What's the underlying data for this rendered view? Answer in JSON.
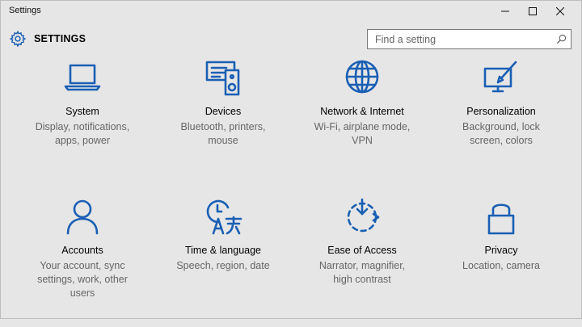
{
  "window": {
    "title": "Settings",
    "controls": [
      "minimize-icon",
      "maximize-icon",
      "close-icon"
    ]
  },
  "header": {
    "title": "SETTINGS",
    "icon": "gear-icon"
  },
  "search": {
    "placeholder": "Find a setting",
    "value": "",
    "icon": "search-icon"
  },
  "tiles": [
    {
      "label": "System",
      "desc1": "Display, notifications,",
      "desc2": "apps, power",
      "desc3": "",
      "icon": "laptop-icon"
    },
    {
      "label": "Devices",
      "desc1": "Bluetooth, printers,",
      "desc2": "mouse",
      "desc3": "",
      "icon": "devices-icon"
    },
    {
      "label": "Network & Internet",
      "desc1": "Wi-Fi, airplane mode,",
      "desc2": "VPN",
      "desc3": "",
      "icon": "globe-icon"
    },
    {
      "label": "Personalization",
      "desc1": "Background, lock",
      "desc2": "screen, colors",
      "desc3": "",
      "icon": "paint-icon"
    },
    {
      "label": "Accounts",
      "desc1": "Your account, sync",
      "desc2": "settings, work, other",
      "desc3": "users",
      "icon": "person-icon"
    },
    {
      "label": "Time & language",
      "desc1": "Speech, region, date",
      "desc2": "",
      "desc3": "",
      "icon": "time-language-icon"
    },
    {
      "label": "Ease of Access",
      "desc1": "Narrator, magnifier,",
      "desc2": "high contrast",
      "desc3": "",
      "icon": "ease-of-access-icon"
    },
    {
      "label": "Privacy",
      "desc1": "Location, camera",
      "desc2": "",
      "desc3": "",
      "icon": "lock-icon"
    }
  ],
  "colors": {
    "accent": "#1a5fb4",
    "background": "#e6e6e6",
    "secondary_text": "#666666"
  }
}
